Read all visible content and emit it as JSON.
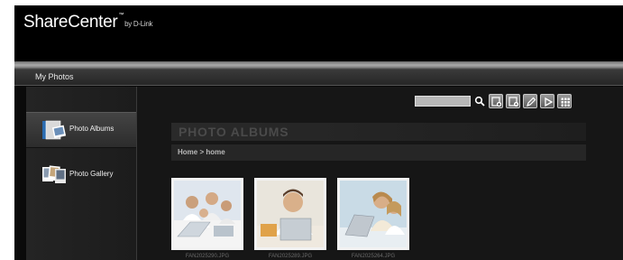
{
  "header": {
    "brand": "ShareCenter",
    "trademark": "™",
    "brand_sub": "by D-Link"
  },
  "titlebar": {
    "title": "My Photos"
  },
  "sidebar": {
    "items": [
      {
        "label": "Photo Albums",
        "icon": "photo-albums-icon",
        "active": true
      },
      {
        "label": "Photo Gallery",
        "icon": "photo-gallery-icon",
        "active": false
      }
    ]
  },
  "toolbar": {
    "search_placeholder": "",
    "buttons": [
      "search-icon",
      "add-album-icon",
      "upload-icon",
      "edit-icon",
      "slideshow-icon",
      "grid-view-icon"
    ]
  },
  "main": {
    "section_title": "PHOTO ALBUMS",
    "breadcrumb": {
      "root": "Home",
      "separator": " > ",
      "current": "home"
    },
    "photos": [
      {
        "caption": "FAN2025290.JPG"
      },
      {
        "caption": "FAN2025289.JPG"
      },
      {
        "caption": "FAN2025264.JPG"
      }
    ]
  },
  "colors": {
    "background": "#0a0a0a",
    "panel": "#161616",
    "text": "#f0f0f0"
  }
}
